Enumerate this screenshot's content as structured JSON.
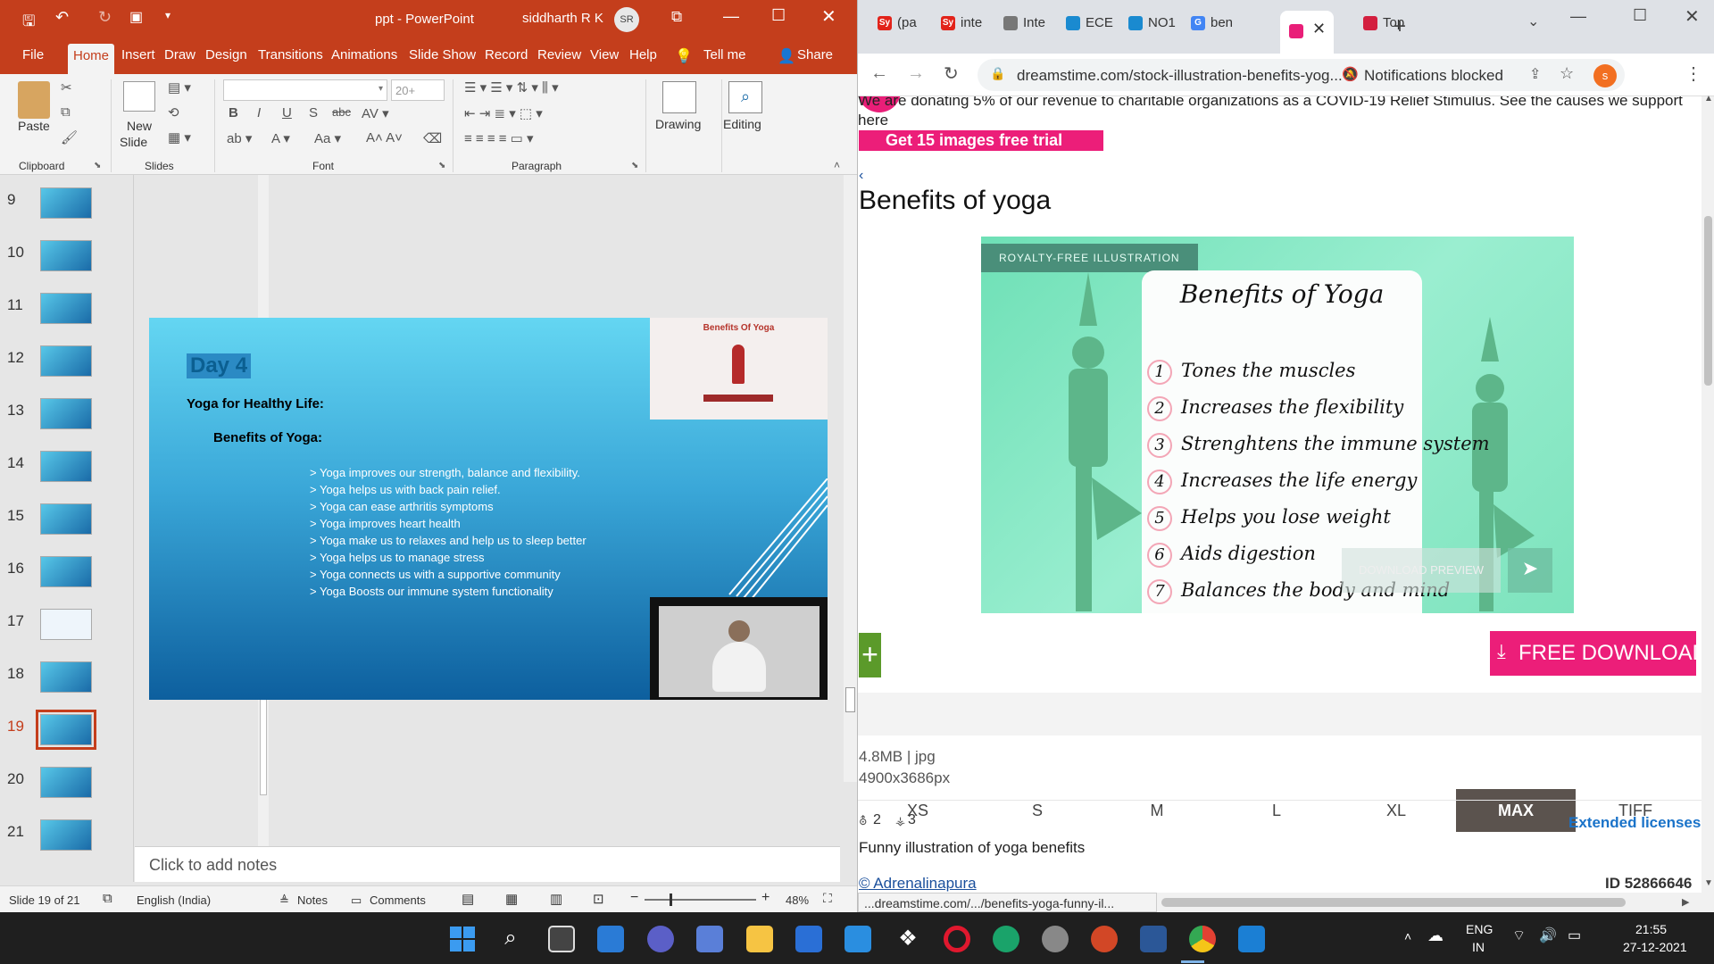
{
  "ppt": {
    "window_title": "ppt  -  PowerPoint",
    "user_name": "siddharth R K",
    "user_initials": "SR",
    "menu": [
      "File",
      "Home",
      "Insert",
      "Draw",
      "Design",
      "Transitions",
      "Animations",
      "Slide Show",
      "Record",
      "Review",
      "View",
      "Help",
      "Tell me",
      "Share"
    ],
    "ribbon": {
      "paste": "Paste",
      "new_slide_1": "New",
      "new_slide_2": "Slide",
      "font_size": "20+",
      "drawing": "Drawing",
      "editing": "Editing",
      "groups": [
        "Clipboard",
        "Slides",
        "Font",
        "Paragraph"
      ]
    },
    "thumb_numbers": [
      "9",
      "10",
      "11",
      "12",
      "13",
      "14",
      "15",
      "16",
      "17",
      "18",
      "19",
      "20",
      "21"
    ],
    "slide": {
      "day": "Day 4",
      "heading1": "Yoga for Healthy Life:",
      "heading2": "Benefits of Yoga:",
      "bullets": [
        "Yoga improves our strength, balance and flexibility.",
        "Yoga helps us with back pain relief.",
        "Yoga can ease arthritis symptoms",
        "Yoga improves heart health",
        "Yoga make us to relaxes and help us to sleep better",
        "Yoga helps us to manage stress",
        "Yoga connects us with a supportive community",
        "Yoga Boosts our immune system functionality"
      ],
      "image_title": "Benefits Of Yoga"
    },
    "notes_placeholder": "Click to add notes",
    "status": {
      "slide_of": "Slide 19 of 21",
      "language": "English (India)",
      "notes": "Notes",
      "comments": "Comments",
      "zoom": "48%"
    }
  },
  "chrome": {
    "tabs": [
      "(pa",
      "inte",
      "Inte",
      "ECE",
      "NO1",
      "ben",
      "Top"
    ],
    "url": "dreamstime.com/stock-illustration-benefits-yog...",
    "notifications": "Notifications blocked",
    "profile_initial": "s",
    "covid_banner": "We are donating 5% of our revenue to charitable organizations as a COVID-19 Relief Stimulus. See the causes we support here",
    "trial_button": "Get 15 images free trial",
    "page_title": "Benefits of yoga",
    "badge": "ROYALTY-FREE ILLUSTRATION",
    "illustration": {
      "title": "Benefits of Yoga",
      "items": [
        {
          "n": "1",
          "text": "Tones the muscles"
        },
        {
          "n": "2",
          "text": "Increases the flexibility"
        },
        {
          "n": "3",
          "text": "Strenghtens the immune system"
        },
        {
          "n": "4",
          "text": "Increases the life energy"
        },
        {
          "n": "5",
          "text": "Helps you lose weight"
        },
        {
          "n": "6",
          "text": "Aids digestion"
        },
        {
          "n": "7",
          "text": "Balances the body and mind"
        }
      ]
    },
    "download_preview": "DOWNLOAD PREVIEW",
    "free_download": "FREE DOWNLOAD",
    "sizes": [
      "XS",
      "S",
      "M",
      "L",
      "XL",
      "MAX",
      "TIFF"
    ],
    "file_info": "4.8MB | jpg",
    "dimensions": "4900x3686px",
    "stats_a": "2",
    "stats_b": "3",
    "extended": "Extended licenses",
    "description": "Funny illustration of yoga benefits",
    "author": "© Adrenalinapura",
    "image_id": "ID 52866646",
    "status_url": "...dreamstime.com/.../benefits-yoga-funny-il..."
  },
  "taskbar": {
    "lang1": "ENG",
    "lang2": "IN",
    "time": "21:55",
    "date": "27-12-2021"
  }
}
